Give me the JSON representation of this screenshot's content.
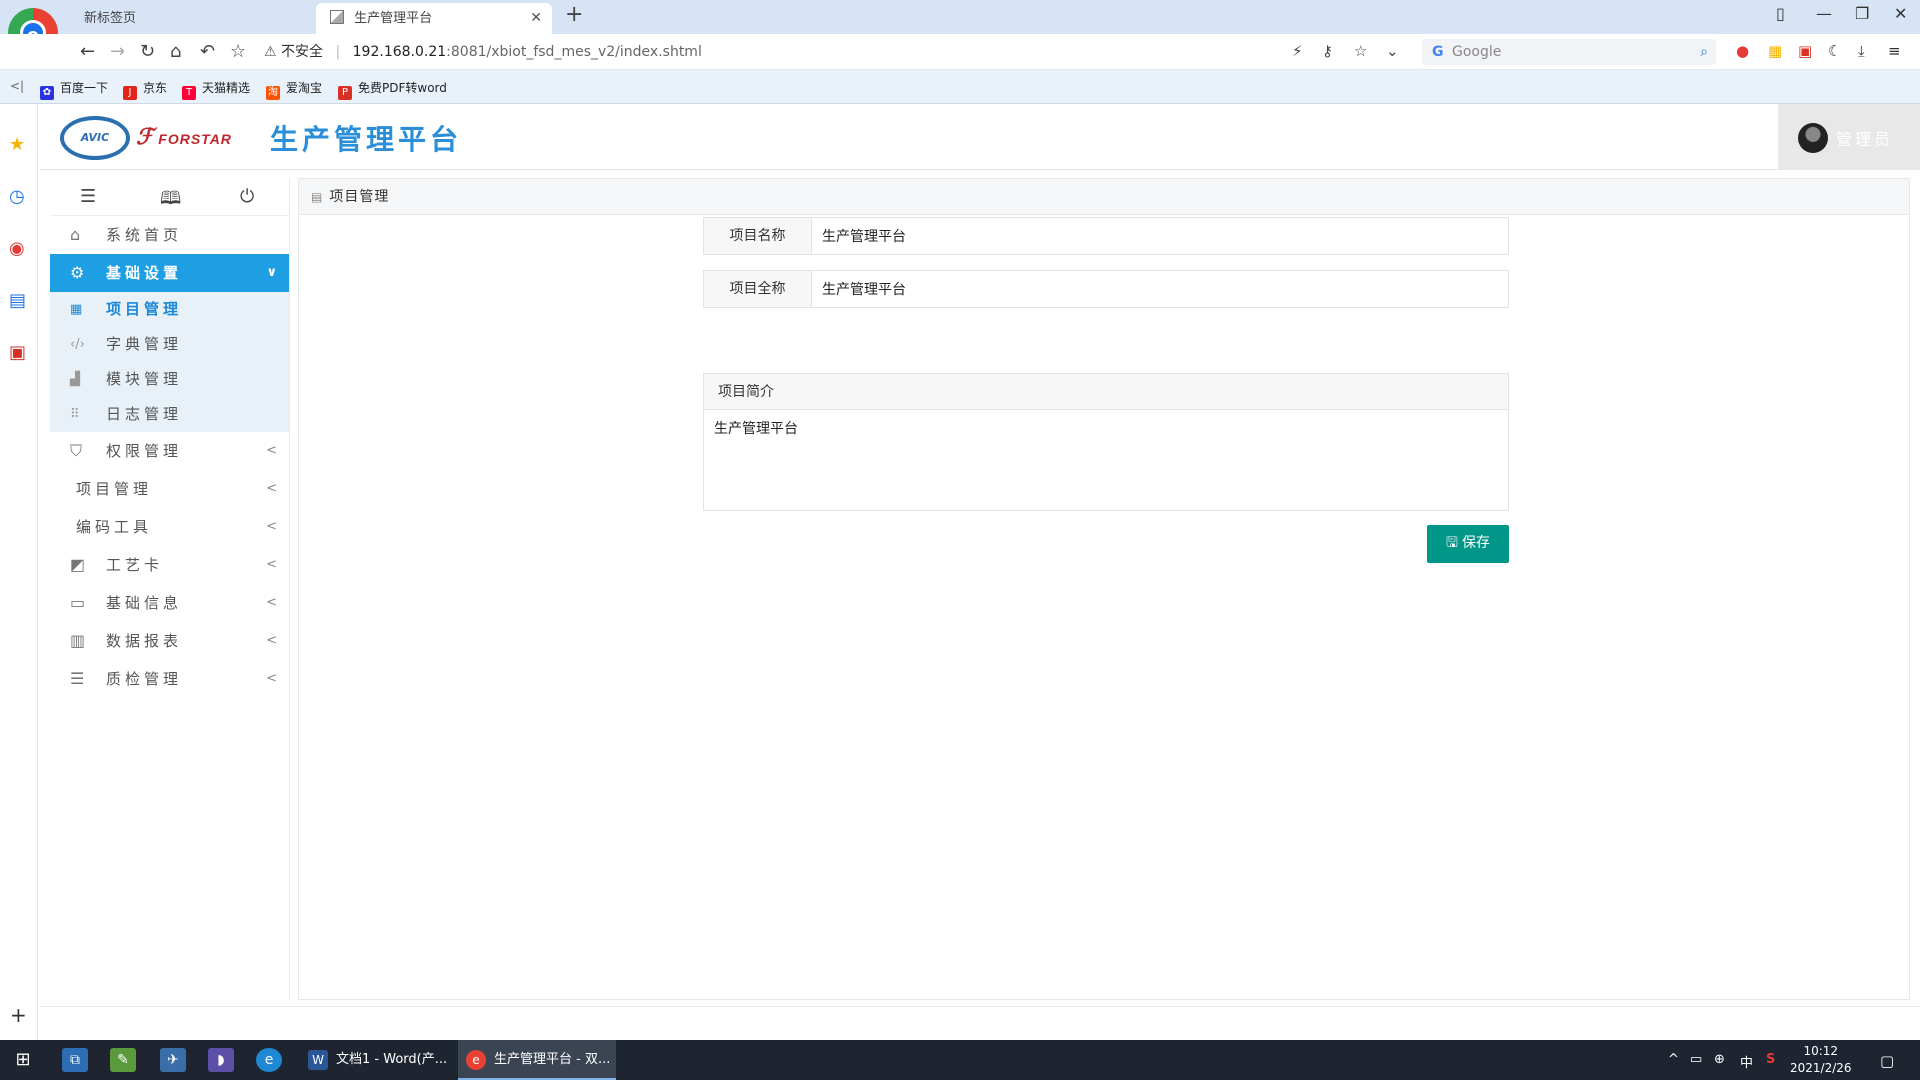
{
  "browser": {
    "tabs": [
      {
        "label": "新标签页",
        "active": false
      },
      {
        "label": "生产管理平台",
        "active": true
      }
    ],
    "address": {
      "security": "不安全",
      "host": "192.168.0.21",
      "path": ":8081/xbiot_fsd_mes_v2/index.shtml"
    },
    "search_placeholder": "Google",
    "bookmarks": [
      {
        "label": "百度一下",
        "icon": "baidu-icon",
        "color": "#2932e1"
      },
      {
        "label": "京东",
        "icon": "jd-icon",
        "color": "#e1251b"
      },
      {
        "label": "天猫精选",
        "icon": "tmall-icon",
        "color": "#ff0036"
      },
      {
        "label": "爱淘宝",
        "icon": "taobao-icon",
        "color": "#ff5000"
      },
      {
        "label": "免费PDF转word",
        "icon": "pdf-icon",
        "color": "#d93025"
      }
    ]
  },
  "header": {
    "logo_avic": "AVIC",
    "logo_forstar": "FORSTAR",
    "title": "生产管理平台",
    "user": "管理员"
  },
  "sidebar": {
    "items": [
      {
        "label": "系统首页",
        "icon": "home-icon"
      },
      {
        "label": "基础设置",
        "icon": "gear-icon",
        "open": true,
        "children": [
          {
            "label": "项目管理",
            "icon": "table-icon",
            "current": true
          },
          {
            "label": "字典管理",
            "icon": "code-icon"
          },
          {
            "label": "模块管理",
            "icon": "module-icon"
          },
          {
            "label": "日志管理",
            "icon": "grid-icon"
          }
        ]
      },
      {
        "label": "权限管理",
        "icon": "shield-icon"
      },
      {
        "label": "项目管理",
        "icon": ""
      },
      {
        "label": "编码工具",
        "icon": ""
      },
      {
        "label": "工艺卡",
        "icon": "card-icon"
      },
      {
        "label": "基础信息",
        "icon": "monitor-icon"
      },
      {
        "label": "数据报表",
        "icon": "table-icon"
      },
      {
        "label": "质检管理",
        "icon": "layers-icon"
      }
    ]
  },
  "breadcrumb": "项目管理",
  "form": {
    "name_label": "项目名称",
    "name_value": "生产管理平台",
    "fullname_label": "项目全称",
    "fullname_value": "生产管理平台",
    "intro_label": "项目简介",
    "intro_value": "生产管理平台",
    "save_label": "保存"
  },
  "taskbar": {
    "tasks": [
      {
        "label": "文档1 - Word(产...",
        "icon": "word-icon",
        "color": "#2b579a"
      },
      {
        "label": "生产管理平台 - 双...",
        "icon": "browser-icon",
        "color": "#e94235"
      }
    ],
    "ime": "中",
    "time": "10:12",
    "date": "2021/2/26"
  },
  "colors": {
    "accent": "#1e9fe3",
    "title": "#2a8fd8",
    "save": "#009688"
  }
}
